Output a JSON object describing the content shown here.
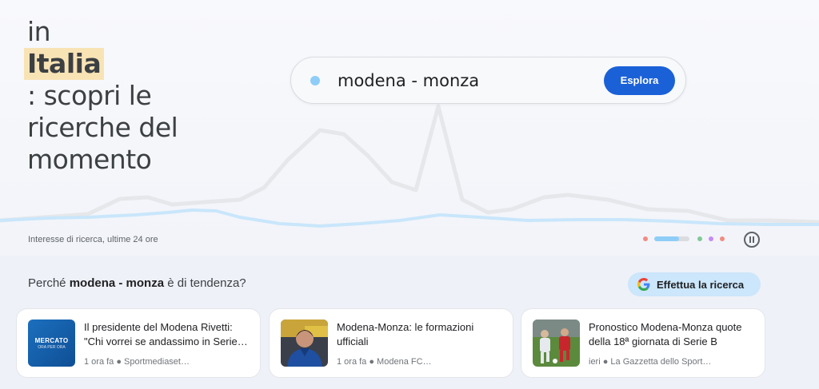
{
  "headline": {
    "line1": "in",
    "highlight": "Italia",
    "line3": ": scopri le",
    "line4": "ricerche del",
    "line5": "momento"
  },
  "search": {
    "query": "modena - monza",
    "explore_label": "Esplora"
  },
  "interest_label": "Interesse di ricerca, ultime 24 ore",
  "carousel": {
    "dot_colors": [
      "#f28b82",
      "#81c995",
      "#c58af9",
      "#f28b82"
    ],
    "active_color": "#8ecdf8",
    "progress": 0.7
  },
  "trending": {
    "prefix": "Perché ",
    "term": "modena - monza",
    "suffix": " è di tendenza?",
    "search_button": "Effettua la ricerca"
  },
  "articles": [
    {
      "title": "Il presidente del Modena Rivetti: \"Chi vorrei se andassimo in Serie…",
      "meta": "1 ora fa ● Sportmediaset…",
      "thumb_text_1": "MERCATO",
      "thumb_text_2": "ORA PER ORA"
    },
    {
      "title": "Modena-Monza: le formazioni ufficiali",
      "meta": "1 ora fa ● Modena FC…"
    },
    {
      "title": "Pronostico Modena-Monza quote della 18ª giornata di Serie B",
      "meta": "ieri ● La Gazzetta dello Sport…"
    }
  ],
  "colors": {
    "accent": "#1a61d8",
    "trend_line": "#c9e6fb",
    "bg_line": "#e6e7ea",
    "highlight": "#f8e3b5"
  }
}
